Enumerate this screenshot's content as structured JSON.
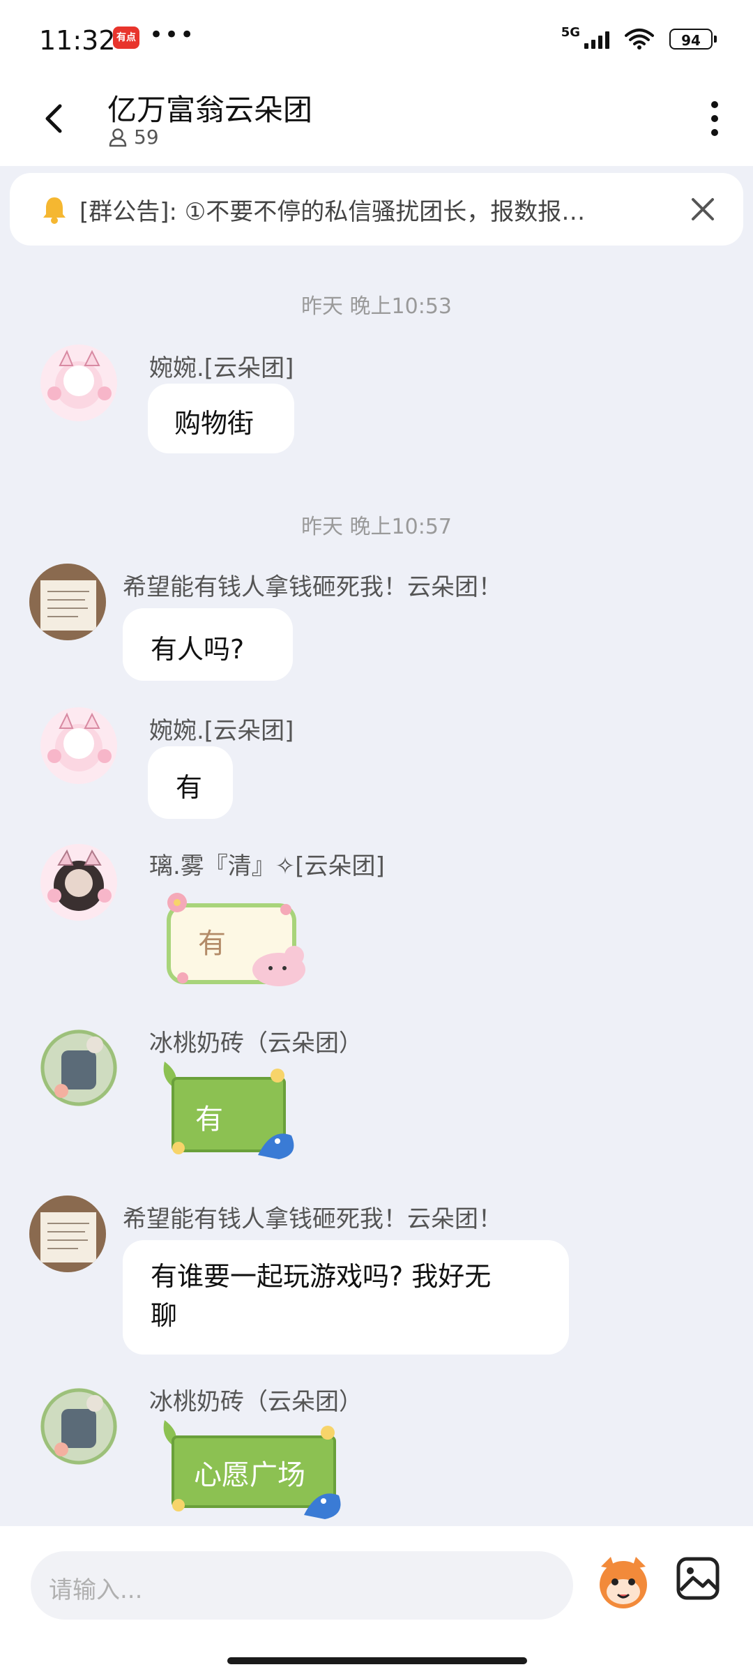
{
  "status": {
    "time": "11:32",
    "app_badge": "有点",
    "more_dots": "•••",
    "network": "5G",
    "battery": "94"
  },
  "header": {
    "title": "亿万富翁云朵团",
    "member_count": "59"
  },
  "notice": {
    "text": "[群公告]: ①不要不停的私信骚扰团长，报数报…"
  },
  "timestamps": [
    "昨天 晚上10:53",
    "昨天 晚上10:57"
  ],
  "messages": [
    {
      "sender": "婉婉.[云朵团]",
      "text": "购物街",
      "type": "text"
    },
    {
      "sender": "希望能有钱人拿钱砸死我！云朵团！",
      "text": "有人吗?",
      "type": "text"
    },
    {
      "sender": "婉婉.[云朵团]",
      "text": "有",
      "type": "text"
    },
    {
      "sender": "璃.雾『清』✧[云朵团]",
      "text": "有",
      "type": "sticker"
    },
    {
      "sender": "冰桃奶砖（云朵团）",
      "text": "有",
      "type": "sticker"
    },
    {
      "sender": "希望能有钱人拿钱砸死我！云朵团！",
      "text": "有谁要一起玩游戏吗? 我好无聊",
      "line1": "有谁要一起玩游戏吗? 我好无",
      "line2": "聊",
      "type": "text"
    },
    {
      "sender": "冰桃奶砖（云朵团）",
      "text": "心愿广场",
      "type": "sticker"
    }
  ],
  "input": {
    "placeholder": "请输入..."
  },
  "colors": {
    "accent_pink": "#f7c6d4",
    "sticker_green": "#8cc152",
    "sticker_cream": "#fdf8e4"
  },
  "icons": [
    "back-arrow-icon",
    "person-icon",
    "more-vertical-icon",
    "bell-icon",
    "close-icon",
    "emoji-mascot-icon",
    "image-icon"
  ]
}
